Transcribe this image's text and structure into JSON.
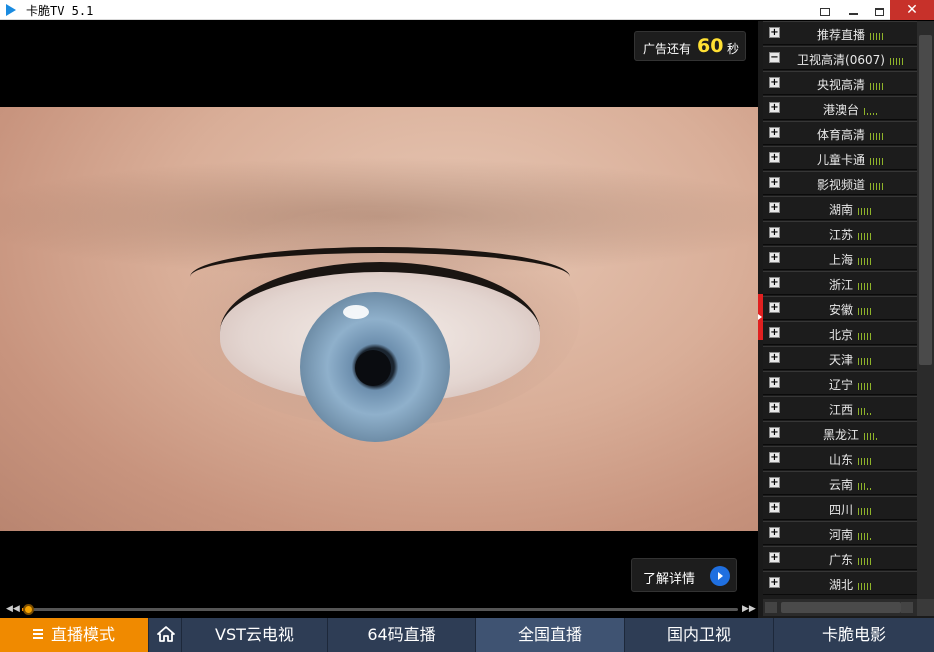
{
  "window": {
    "title": "卡脆TV 5.1"
  },
  "ad": {
    "countdown_label": "广告还有",
    "countdown_value": "60",
    "countdown_unit": "秒",
    "learn_more_label": "了解详情"
  },
  "player": {
    "progress": 0.005
  },
  "channels": [
    {
      "name": "推荐直播",
      "toggle": "+",
      "signal": 5
    },
    {
      "name": "卫视高清(0607)",
      "toggle": "−",
      "signal": 5
    },
    {
      "name": "央视高清",
      "toggle": "+",
      "signal": 5
    },
    {
      "name": "港澳台",
      "toggle": "+",
      "signal": 1
    },
    {
      "name": "体育高清",
      "toggle": "+",
      "signal": 5
    },
    {
      "name": "儿童卡通",
      "toggle": "+",
      "signal": 5
    },
    {
      "name": "影视频道",
      "toggle": "+",
      "signal": 5
    },
    {
      "name": "湖南",
      "toggle": "+",
      "signal": 5
    },
    {
      "name": "江苏",
      "toggle": "+",
      "signal": 5
    },
    {
      "name": "上海",
      "toggle": "+",
      "signal": 5
    },
    {
      "name": "浙江",
      "toggle": "+",
      "signal": 5
    },
    {
      "name": "安徽",
      "toggle": "+",
      "signal": 5
    },
    {
      "name": "北京",
      "toggle": "+",
      "signal": 5
    },
    {
      "name": "天津",
      "toggle": "+",
      "signal": 5
    },
    {
      "name": "辽宁",
      "toggle": "+",
      "signal": 5
    },
    {
      "name": "江西",
      "toggle": "+",
      "signal": 3
    },
    {
      "name": "黑龙江",
      "toggle": "+",
      "signal": 4
    },
    {
      "name": "山东",
      "toggle": "+",
      "signal": 5
    },
    {
      "name": "云南",
      "toggle": "+",
      "signal": 3
    },
    {
      "name": "四川",
      "toggle": "+",
      "signal": 5
    },
    {
      "name": "河南",
      "toggle": "+",
      "signal": 4
    },
    {
      "name": "广东",
      "toggle": "+",
      "signal": 5
    },
    {
      "name": "湖北",
      "toggle": "+",
      "signal": 5
    }
  ],
  "nav": {
    "live_mode": "直播模式",
    "vst": "VST云电视",
    "code64": "64码直播",
    "national": "全国直播",
    "domestic": "国内卫视",
    "movie": "卡脆电影"
  },
  "colors": {
    "accent": "#f08a00",
    "nav_bg": "#2e3d55",
    "nav_active": "#3f5372",
    "signal": "#8fb32a",
    "countdown": "#ffe033",
    "close": "#c7312a"
  },
  "icons": {
    "app": "play-triangle-icon",
    "pin": "pin-icon",
    "minimize": "minimize-icon",
    "maximize": "maximize-icon",
    "close": "close-icon",
    "home": "home-icon",
    "menu": "menu-icon"
  }
}
